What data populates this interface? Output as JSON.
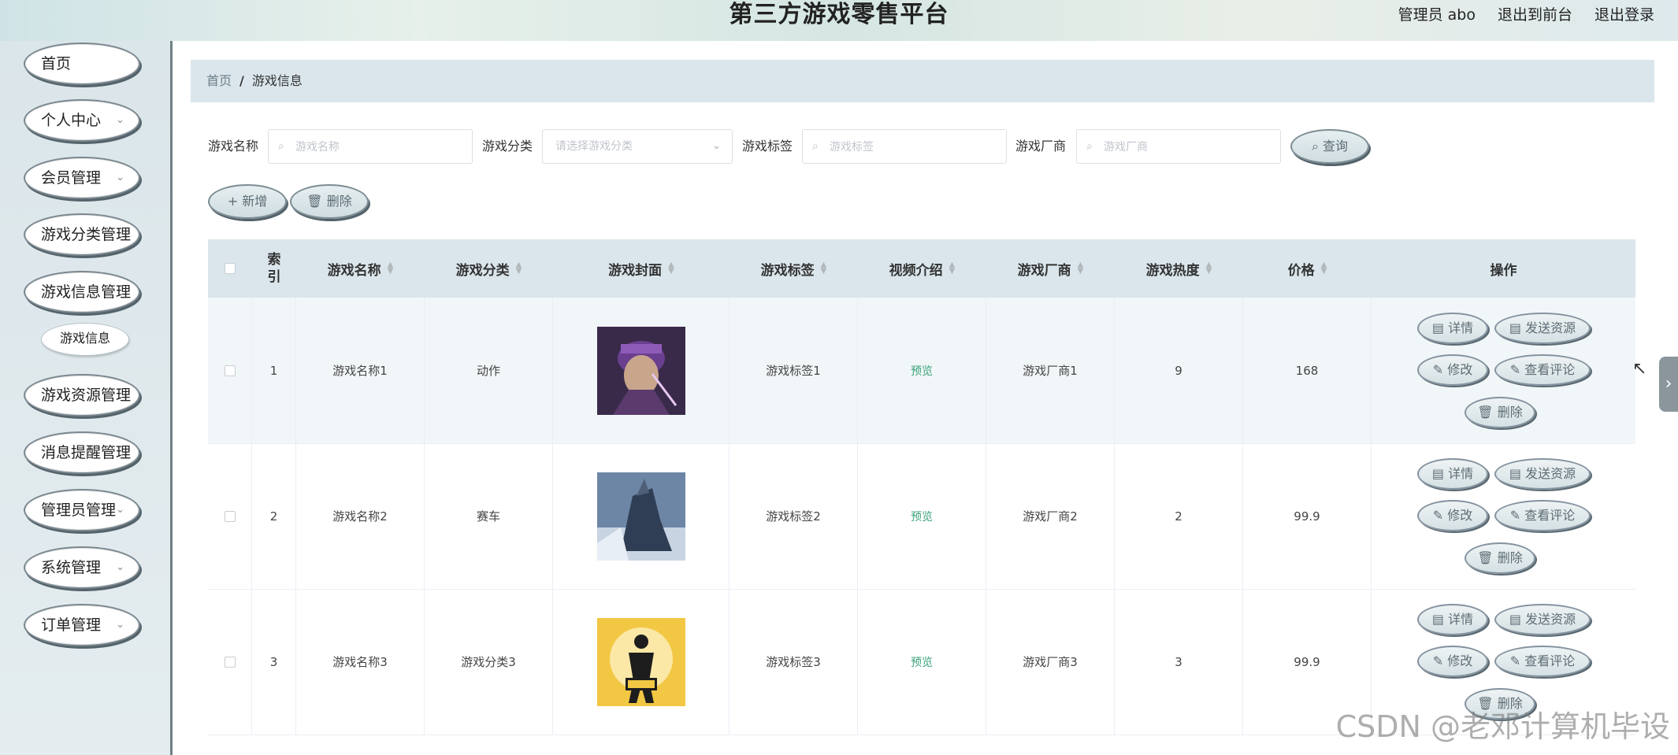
{
  "header": {
    "title": "第三方游戏零售平台",
    "admin_label": "管理员 abo",
    "to_front": "退出到前台",
    "logout": "退出登录"
  },
  "sidebar": {
    "items": [
      {
        "label": "首页",
        "chev": ""
      },
      {
        "label": "个人中心",
        "chev": "⌄"
      },
      {
        "label": "会员管理",
        "chev": "⌄"
      },
      {
        "label": "游戏分类管理",
        "chev": ""
      },
      {
        "label": "游戏信息管理",
        "chev": ""
      },
      {
        "label": "游戏资源管理",
        "chev": ""
      },
      {
        "label": "消息提醒管理",
        "chev": ""
      },
      {
        "label": "管理员管理",
        "chev": "⌄"
      },
      {
        "label": "系统管理",
        "chev": "⌄"
      },
      {
        "label": "订单管理",
        "chev": "⌄"
      }
    ],
    "sub_item": "游戏信息"
  },
  "breadcrumb": {
    "home": "首页",
    "sep": "/",
    "current": "游戏信息"
  },
  "search": {
    "name_label": "游戏名称",
    "name_placeholder": "游戏名称",
    "cat_label": "游戏分类",
    "cat_placeholder": "请选择游戏分类",
    "tag_label": "游戏标签",
    "tag_placeholder": "游戏标签",
    "vendor_label": "游戏厂商",
    "vendor_placeholder": "游戏厂商",
    "query_button": "查询"
  },
  "actions": {
    "add": "+ 新增",
    "delete": "删除"
  },
  "table": {
    "headers": [
      "索引",
      "游戏名称",
      "游戏分类",
      "游戏封面",
      "游戏标签",
      "视频介绍",
      "游戏厂商",
      "游戏热度",
      "价格",
      "操作"
    ],
    "rows": [
      {
        "index": "1",
        "name": "游戏名称1",
        "category": "动作",
        "tag": "游戏标签1",
        "video": "预览",
        "vendor": "游戏厂商1",
        "heat": "9",
        "price": "168"
      },
      {
        "index": "2",
        "name": "游戏名称2",
        "category": "赛车",
        "tag": "游戏标签2",
        "video": "预览",
        "vendor": "游戏厂商2",
        "heat": "2",
        "price": "99.9"
      },
      {
        "index": "3",
        "name": "游戏名称3",
        "category": "游戏分类3",
        "tag": "游戏标签3",
        "video": "预览",
        "vendor": "游戏厂商3",
        "heat": "3",
        "price": "99.9"
      }
    ],
    "op_labels": {
      "detail": "详情",
      "send": "发送资源",
      "edit": "修改",
      "comments": "查看评论",
      "delete": "删除"
    }
  },
  "watermark": "CSDN @老邓计算机毕设",
  "colors": {
    "accent_green": "#3aa27a",
    "header_bg": "#dae6ec",
    "button_border": "#7d8d94"
  }
}
